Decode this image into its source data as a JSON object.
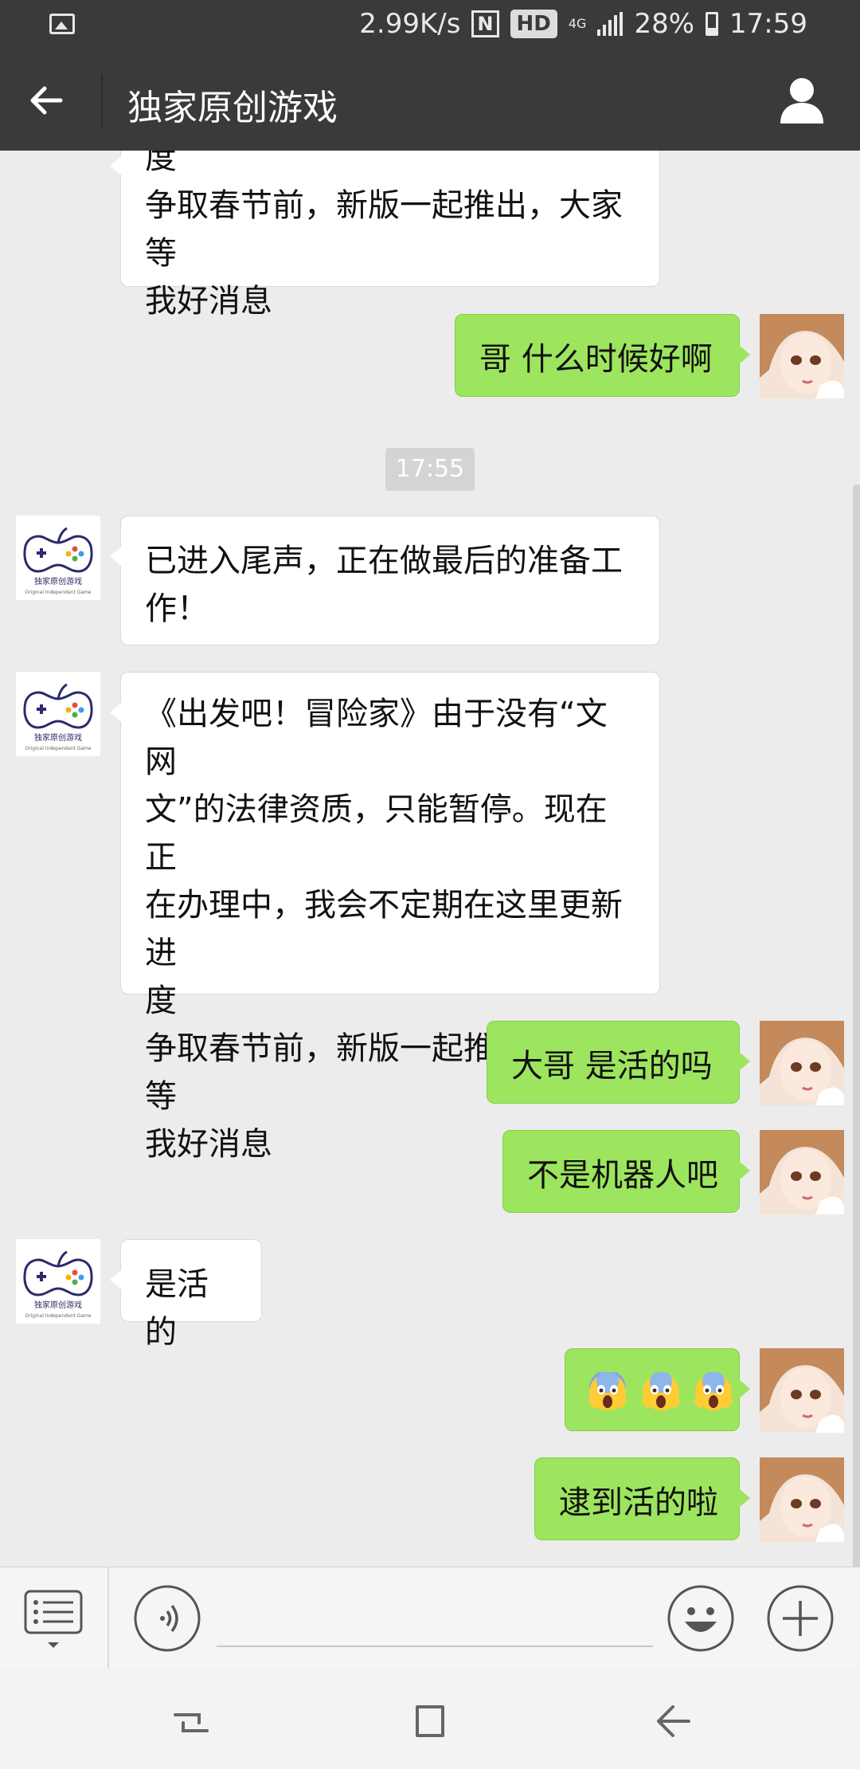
{
  "status_bar": {
    "speed": "2.99K/s",
    "nfc": "N",
    "hd": "HD",
    "network": "4G",
    "battery": "28%",
    "time": "17:59"
  },
  "header": {
    "title": "独家原创游戏"
  },
  "chat": {
    "timestamp": "17:55",
    "messages": [
      {
        "from": "official",
        "lines": [
          "度",
          "争取春节前，新版一起推出，大家等",
          "我好消息"
        ]
      },
      {
        "from": "me",
        "text": "哥  什么时候好啊"
      },
      {
        "from": "official",
        "lines": [
          "已进入尾声，正在做最后的准备工",
          "作！"
        ]
      },
      {
        "from": "official",
        "lines": [
          "《出发吧！冒险家》由于没有“文网",
          "文”的法律资质，只能暂停。现在正",
          "在办理中，我会不定期在这里更新进",
          "度",
          "争取春节前，新版一起推出，大家等",
          "我好消息"
        ]
      },
      {
        "from": "me",
        "text": "大哥  是活的吗"
      },
      {
        "from": "me",
        "text": "不是机器人吧"
      },
      {
        "from": "official",
        "text": "是活的"
      },
      {
        "from": "me",
        "text": "😱😱😱"
      },
      {
        "from": "me",
        "text": "逮到活的啦"
      }
    ],
    "official_avatar": {
      "logo_text": "独家原创游戏",
      "logo_subtext": "Original Independent Game"
    }
  },
  "icons": {
    "back": "back-arrow-icon",
    "profile": "person-icon",
    "menu": "list-menu-icon",
    "voice": "voice-icon",
    "emoji": "smiley-icon",
    "plus": "plus-icon"
  },
  "colors": {
    "bar": "#3a3a3c",
    "bubble_me": "#9de55e",
    "bubble_other": "#ffffff",
    "chat_bg": "#ececec"
  }
}
